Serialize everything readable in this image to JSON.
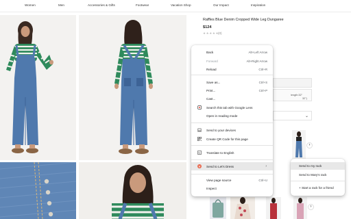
{
  "nav": {
    "items": [
      "Women",
      "Men",
      "Accessories & Gifts",
      "Footwear",
      "Vacation Shop",
      "Our Impact",
      "Inspiration"
    ]
  },
  "product": {
    "title": "Raffles Blue Denim Cropped Wide Leg Dungaree",
    "price": "$124",
    "rating_stars": "★★★★★",
    "review_count": "(0)"
  },
  "colors": {
    "denim": "#4f79ad",
    "denim_dark": "#3d6396",
    "stripe_green": "#2f8a5c",
    "menu_highlight": "#e8e8e8",
    "lens_red": "#ea4335"
  },
  "peek": {
    "length_text": "length:32\"",
    "length_text_2": "32\")"
  },
  "context_menu": {
    "back": {
      "label": "Back",
      "shortcut": "Alt+Left Arrow"
    },
    "forward": {
      "label": "Forward",
      "shortcut": "Alt+Right Arrow"
    },
    "reload": {
      "label": "Reload",
      "shortcut": "Ctrl+R"
    },
    "save_as": {
      "label": "Save as...",
      "shortcut": "Ctrl+S"
    },
    "print": {
      "label": "Print...",
      "shortcut": "Ctrl+P"
    },
    "cast": {
      "label": "Cast..."
    },
    "search_lens": {
      "label": "Search this tab with Google Lens",
      "icon": "lens-icon"
    },
    "reading_mode": {
      "label": "Open in reading mode"
    },
    "send_devices": {
      "label": "Send to your devices",
      "icon": "laptop-icon"
    },
    "qr_code": {
      "label": "Create QR Code for this page",
      "icon": "qr-icon"
    },
    "translate": {
      "label": "Translate to English",
      "icon": "translate-icon"
    },
    "send_lets_dress": {
      "label": "Send to Let's Dress",
      "icon": "lets-dress-icon"
    },
    "view_source": {
      "label": "View page source",
      "shortcut": "Ctrl+U"
    },
    "inspect": {
      "label": "Inspect"
    }
  },
  "submenu": {
    "send_my_rack": "Send to my rack",
    "send_marys_rack": "Send to Mary's rack",
    "start_rack_friend": "+ Start a rack for a friend"
  }
}
